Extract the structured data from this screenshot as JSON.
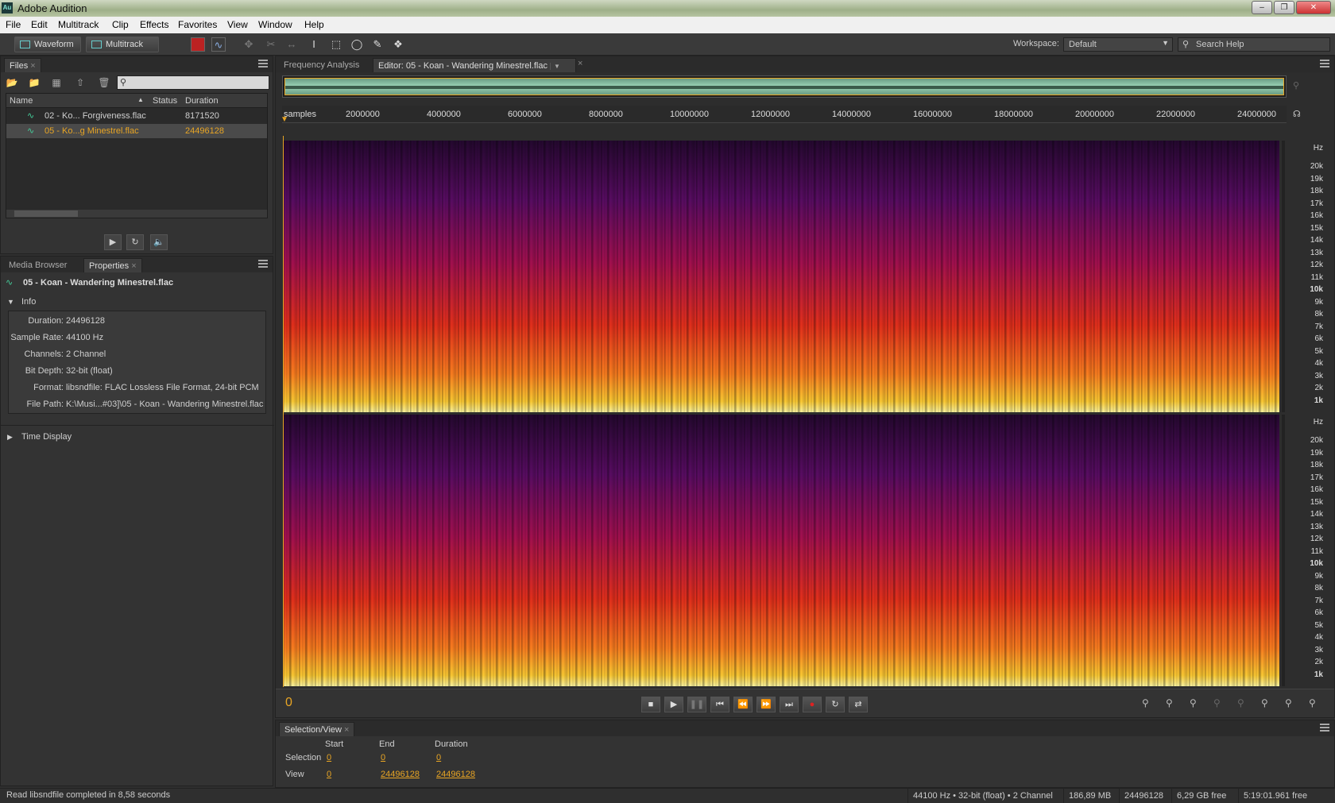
{
  "window": {
    "title": "Adobe Audition",
    "app_icon": "Au"
  },
  "menu": [
    "File",
    "Edit",
    "Multitrack",
    "Clip",
    "Effects",
    "Favorites",
    "View",
    "Window",
    "Help"
  ],
  "toolbar": {
    "waveform_label": "Waveform",
    "multitrack_label": "Multitrack",
    "workspace_label": "Workspace:",
    "workspace_value": "Default",
    "search_placeholder": "Search Help"
  },
  "files_panel": {
    "tab_label": "Files",
    "columns": [
      "Name",
      "Status",
      "Duration"
    ],
    "files": [
      {
        "name": "02 - Ko... Forgiveness.flac",
        "duration": "8171520",
        "selected": false
      },
      {
        "name": "05 - Ko...g Minestrel.flac",
        "duration": "24496128",
        "selected": true
      }
    ]
  },
  "props_panel": {
    "tabs": [
      "Media Browser",
      "Properties"
    ],
    "file_title": "05 - Koan - Wandering Minestrel.flac",
    "info_label": "Info",
    "info": [
      {
        "k": "Duration:",
        "v": "24496128"
      },
      {
        "k": "Sample Rate:",
        "v": "44100 Hz"
      },
      {
        "k": "Channels:",
        "v": "2 Channel"
      },
      {
        "k": "Bit Depth:",
        "v": "32-bit (float)"
      },
      {
        "k": "Format:",
        "v": "libsndfile: FLAC Lossless File Format, 24-bit PCM"
      },
      {
        "k": "File Path:",
        "v": "K:\\Musi...#03]\\05 - Koan - Wandering Minestrel.flac"
      }
    ],
    "time_display_label": "Time Display"
  },
  "editor": {
    "tabs": [
      "Frequency Analysis",
      "Editor: 05 - Koan - Wandering Minestrel.flac"
    ],
    "ruler_unit": "samples",
    "ruler_ticks": [
      "2000000",
      "4000000",
      "6000000",
      "8000000",
      "10000000",
      "12000000",
      "14000000",
      "16000000",
      "18000000",
      "20000000",
      "22000000",
      "24000000"
    ],
    "hz_label": "Hz",
    "hz_ticks": [
      "20k",
      "19k",
      "18k",
      "17k",
      "16k",
      "15k",
      "14k",
      "13k",
      "12k",
      "11k",
      "10k",
      "9k",
      "8k",
      "7k",
      "6k",
      "5k",
      "4k",
      "3k",
      "2k",
      "1k"
    ],
    "current_time": "0",
    "display": "spectral frequency"
  },
  "selection_view": {
    "tab_label": "Selection/View",
    "headers": [
      "Start",
      "End",
      "Duration"
    ],
    "selection_label": "Selection",
    "selection": [
      "0",
      "0",
      "0"
    ],
    "view_label": "View",
    "view": [
      "0",
      "24496128",
      "24496128"
    ]
  },
  "status": {
    "message": "Read libsndfile completed in 8,58 seconds",
    "format": "44100 Hz • 32-bit (float) • 2 Channel",
    "size": "186,89 MB",
    "duration": "24496128",
    "free": "6,29 GB free",
    "time_free": "5:19:01.961 free"
  },
  "colors": {
    "accent": "#e8a524",
    "panel_bg": "#333333",
    "spectral_hot": "#ffcc33"
  }
}
